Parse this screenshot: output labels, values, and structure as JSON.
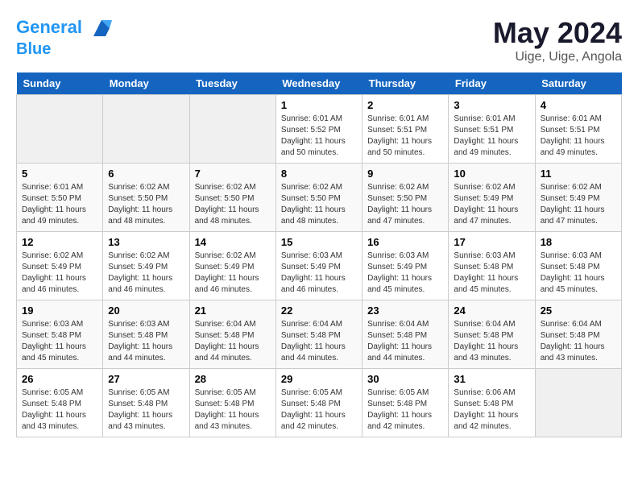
{
  "header": {
    "logo_line1": "General",
    "logo_line2": "Blue",
    "month": "May 2024",
    "location": "Uige, Uige, Angola"
  },
  "weekdays": [
    "Sunday",
    "Monday",
    "Tuesday",
    "Wednesday",
    "Thursday",
    "Friday",
    "Saturday"
  ],
  "weeks": [
    [
      {
        "day": "",
        "info": ""
      },
      {
        "day": "",
        "info": ""
      },
      {
        "day": "",
        "info": ""
      },
      {
        "day": "1",
        "info": "Sunrise: 6:01 AM\nSunset: 5:52 PM\nDaylight: 11 hours\nand 50 minutes."
      },
      {
        "day": "2",
        "info": "Sunrise: 6:01 AM\nSunset: 5:51 PM\nDaylight: 11 hours\nand 50 minutes."
      },
      {
        "day": "3",
        "info": "Sunrise: 6:01 AM\nSunset: 5:51 PM\nDaylight: 11 hours\nand 49 minutes."
      },
      {
        "day": "4",
        "info": "Sunrise: 6:01 AM\nSunset: 5:51 PM\nDaylight: 11 hours\nand 49 minutes."
      }
    ],
    [
      {
        "day": "5",
        "info": "Sunrise: 6:01 AM\nSunset: 5:50 PM\nDaylight: 11 hours\nand 49 minutes."
      },
      {
        "day": "6",
        "info": "Sunrise: 6:02 AM\nSunset: 5:50 PM\nDaylight: 11 hours\nand 48 minutes."
      },
      {
        "day": "7",
        "info": "Sunrise: 6:02 AM\nSunset: 5:50 PM\nDaylight: 11 hours\nand 48 minutes."
      },
      {
        "day": "8",
        "info": "Sunrise: 6:02 AM\nSunset: 5:50 PM\nDaylight: 11 hours\nand 48 minutes."
      },
      {
        "day": "9",
        "info": "Sunrise: 6:02 AM\nSunset: 5:50 PM\nDaylight: 11 hours\nand 47 minutes."
      },
      {
        "day": "10",
        "info": "Sunrise: 6:02 AM\nSunset: 5:49 PM\nDaylight: 11 hours\nand 47 minutes."
      },
      {
        "day": "11",
        "info": "Sunrise: 6:02 AM\nSunset: 5:49 PM\nDaylight: 11 hours\nand 47 minutes."
      }
    ],
    [
      {
        "day": "12",
        "info": "Sunrise: 6:02 AM\nSunset: 5:49 PM\nDaylight: 11 hours\nand 46 minutes."
      },
      {
        "day": "13",
        "info": "Sunrise: 6:02 AM\nSunset: 5:49 PM\nDaylight: 11 hours\nand 46 minutes."
      },
      {
        "day": "14",
        "info": "Sunrise: 6:02 AM\nSunset: 5:49 PM\nDaylight: 11 hours\nand 46 minutes."
      },
      {
        "day": "15",
        "info": "Sunrise: 6:03 AM\nSunset: 5:49 PM\nDaylight: 11 hours\nand 46 minutes."
      },
      {
        "day": "16",
        "info": "Sunrise: 6:03 AM\nSunset: 5:49 PM\nDaylight: 11 hours\nand 45 minutes."
      },
      {
        "day": "17",
        "info": "Sunrise: 6:03 AM\nSunset: 5:48 PM\nDaylight: 11 hours\nand 45 minutes."
      },
      {
        "day": "18",
        "info": "Sunrise: 6:03 AM\nSunset: 5:48 PM\nDaylight: 11 hours\nand 45 minutes."
      }
    ],
    [
      {
        "day": "19",
        "info": "Sunrise: 6:03 AM\nSunset: 5:48 PM\nDaylight: 11 hours\nand 45 minutes."
      },
      {
        "day": "20",
        "info": "Sunrise: 6:03 AM\nSunset: 5:48 PM\nDaylight: 11 hours\nand 44 minutes."
      },
      {
        "day": "21",
        "info": "Sunrise: 6:04 AM\nSunset: 5:48 PM\nDaylight: 11 hours\nand 44 minutes."
      },
      {
        "day": "22",
        "info": "Sunrise: 6:04 AM\nSunset: 5:48 PM\nDaylight: 11 hours\nand 44 minutes."
      },
      {
        "day": "23",
        "info": "Sunrise: 6:04 AM\nSunset: 5:48 PM\nDaylight: 11 hours\nand 44 minutes."
      },
      {
        "day": "24",
        "info": "Sunrise: 6:04 AM\nSunset: 5:48 PM\nDaylight: 11 hours\nand 43 minutes."
      },
      {
        "day": "25",
        "info": "Sunrise: 6:04 AM\nSunset: 5:48 PM\nDaylight: 11 hours\nand 43 minutes."
      }
    ],
    [
      {
        "day": "26",
        "info": "Sunrise: 6:05 AM\nSunset: 5:48 PM\nDaylight: 11 hours\nand 43 minutes."
      },
      {
        "day": "27",
        "info": "Sunrise: 6:05 AM\nSunset: 5:48 PM\nDaylight: 11 hours\nand 43 minutes."
      },
      {
        "day": "28",
        "info": "Sunrise: 6:05 AM\nSunset: 5:48 PM\nDaylight: 11 hours\nand 43 minutes."
      },
      {
        "day": "29",
        "info": "Sunrise: 6:05 AM\nSunset: 5:48 PM\nDaylight: 11 hours\nand 42 minutes."
      },
      {
        "day": "30",
        "info": "Sunrise: 6:05 AM\nSunset: 5:48 PM\nDaylight: 11 hours\nand 42 minutes."
      },
      {
        "day": "31",
        "info": "Sunrise: 6:06 AM\nSunset: 5:48 PM\nDaylight: 11 hours\nand 42 minutes."
      },
      {
        "day": "",
        "info": ""
      }
    ]
  ]
}
